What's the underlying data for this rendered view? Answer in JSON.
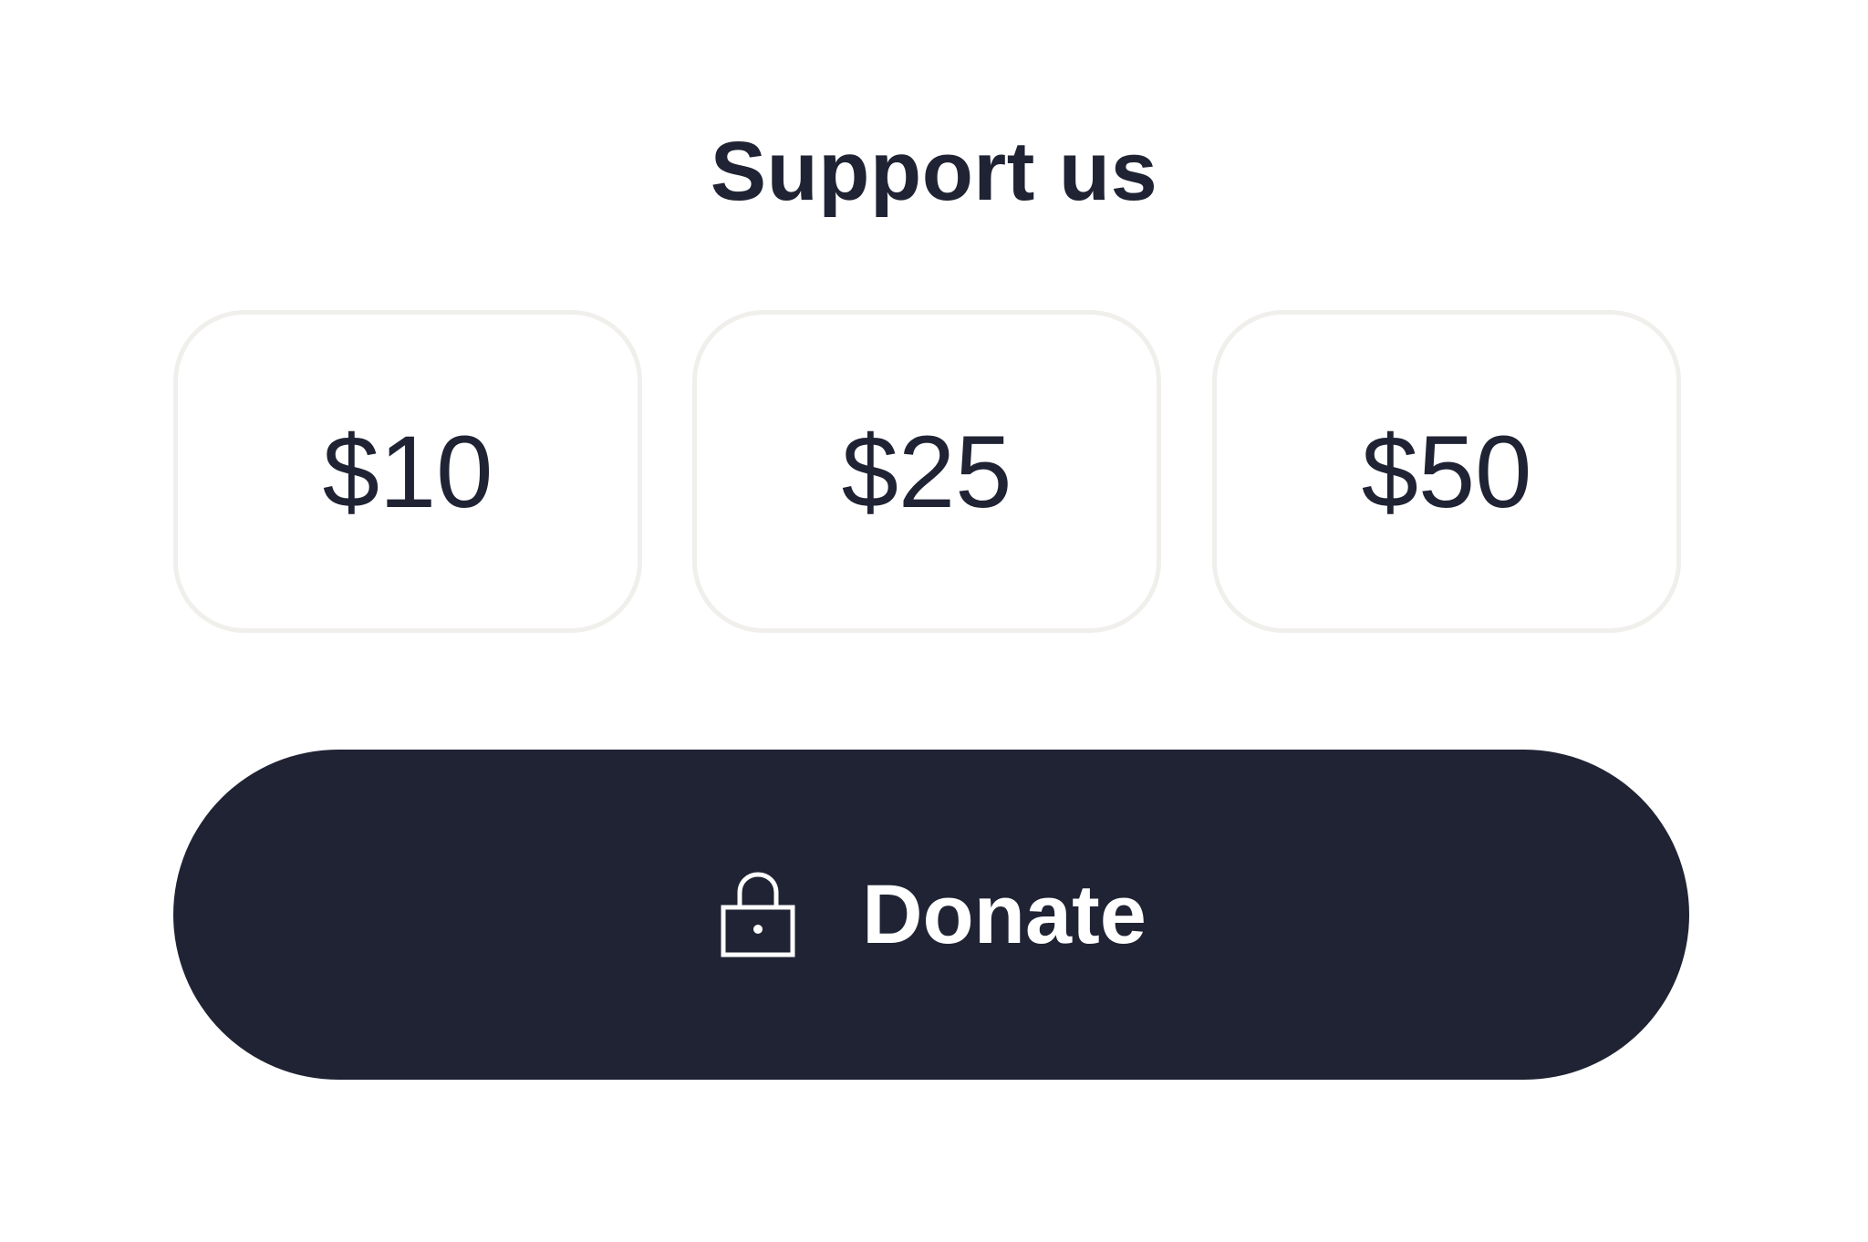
{
  "widget": {
    "title": "Support us",
    "amounts": [
      {
        "label": "$10"
      },
      {
        "label": "$25"
      },
      {
        "label": "$50"
      }
    ],
    "donate": {
      "label": "Donate",
      "icon": "lock-icon"
    }
  },
  "colors": {
    "background": "#ffffff",
    "text": "#1f2333",
    "button": "#1f2333",
    "button_text": "#ffffff",
    "card_border": "#f0efec"
  }
}
